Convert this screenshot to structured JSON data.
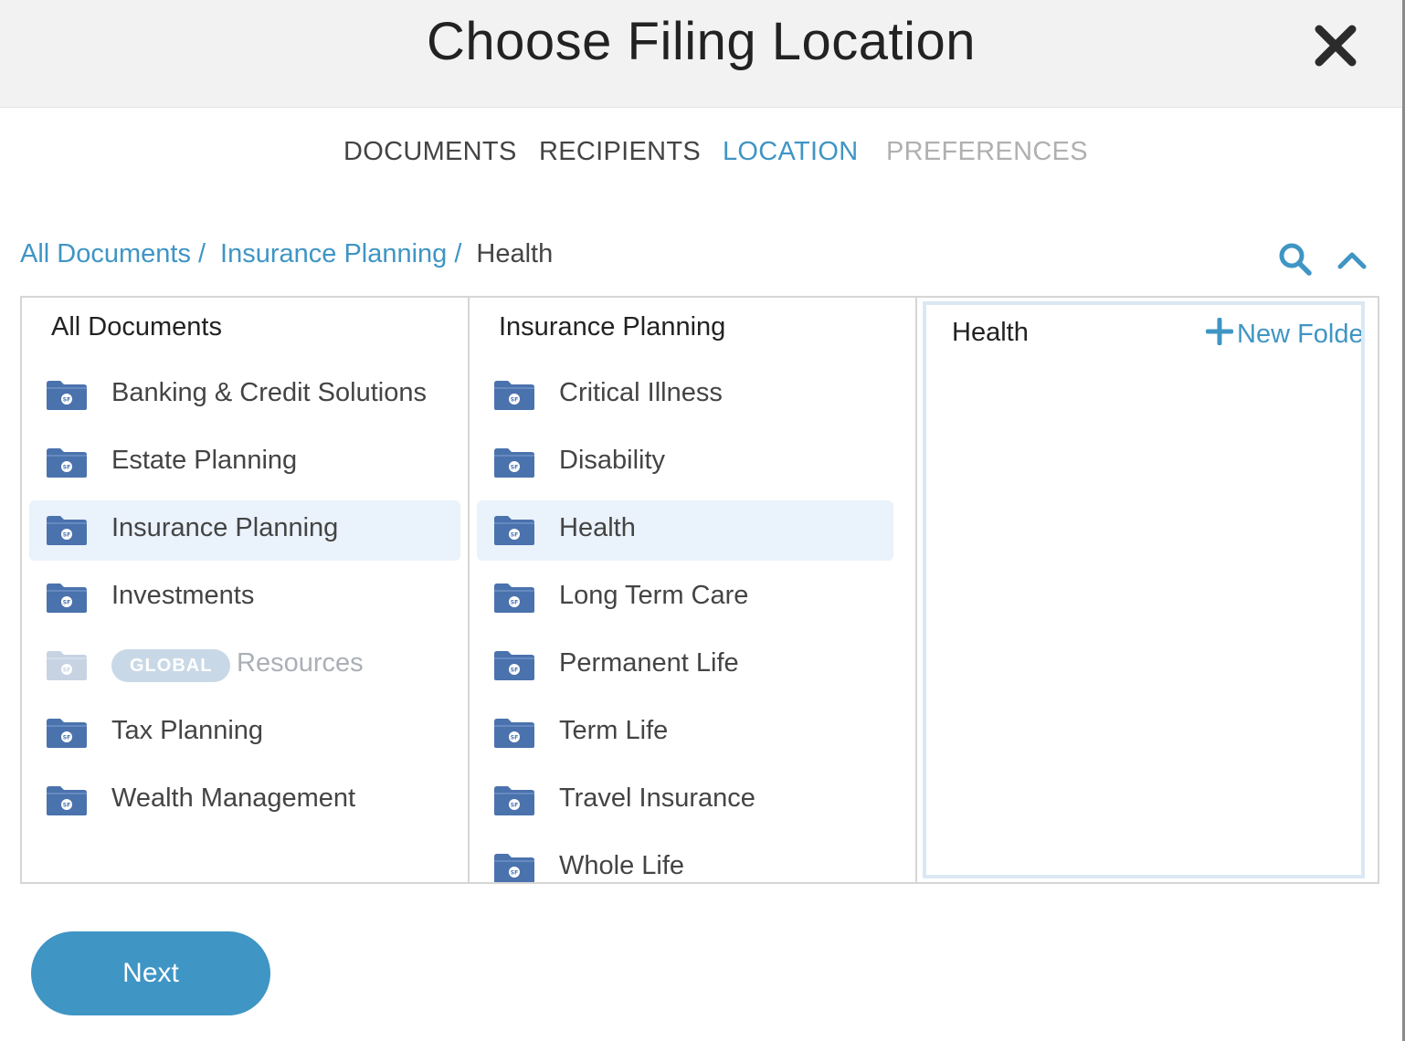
{
  "dialog": {
    "title": "Choose Filing Location"
  },
  "tabs": [
    {
      "label": "DOCUMENTS",
      "state": "done"
    },
    {
      "label": "RECIPIENTS",
      "state": "done"
    },
    {
      "label": "LOCATION",
      "state": "active"
    },
    {
      "label": "PREFERENCES",
      "state": "disabled"
    }
  ],
  "breadcrumb": {
    "items": [
      "All Documents",
      "Insurance Planning"
    ],
    "separator": "/",
    "current": "Health"
  },
  "columns": {
    "col1": {
      "title": "All Documents",
      "items": [
        {
          "label": "Banking & Credit Solutions"
        },
        {
          "label": "Estate Planning"
        },
        {
          "label": "Insurance Planning"
        },
        {
          "label": "Investments"
        },
        {
          "label": "Resources",
          "badge": "GLOBAL"
        },
        {
          "label": "Tax Planning"
        },
        {
          "label": "Wealth Management"
        }
      ]
    },
    "col2": {
      "title": "Insurance Planning",
      "items": [
        {
          "label": "Critical Illness"
        },
        {
          "label": "Disability"
        },
        {
          "label": "Health"
        },
        {
          "label": "Long Term Care"
        },
        {
          "label": "Permanent Life"
        },
        {
          "label": "Term Life"
        },
        {
          "label": "Travel Insurance"
        },
        {
          "label": "Whole Life"
        }
      ]
    },
    "col3": {
      "title": "Health",
      "new_folder_label": "New Folder"
    }
  },
  "folder_badge_text": "SF",
  "footer": {
    "next_label": "Next"
  },
  "icons": {
    "close": "close-icon",
    "search": "search-icon",
    "collapse": "chevron-up-icon",
    "folder": "folder-icon",
    "plus": "plus-icon"
  },
  "colors": {
    "accent": "#3f95c4",
    "folder": "#4a72ad",
    "folder_dim": "#c7d3e2",
    "selected_row": "#eaf2fb",
    "header_bg": "#f2f2f2",
    "disabled_text": "#b0b0b0"
  }
}
